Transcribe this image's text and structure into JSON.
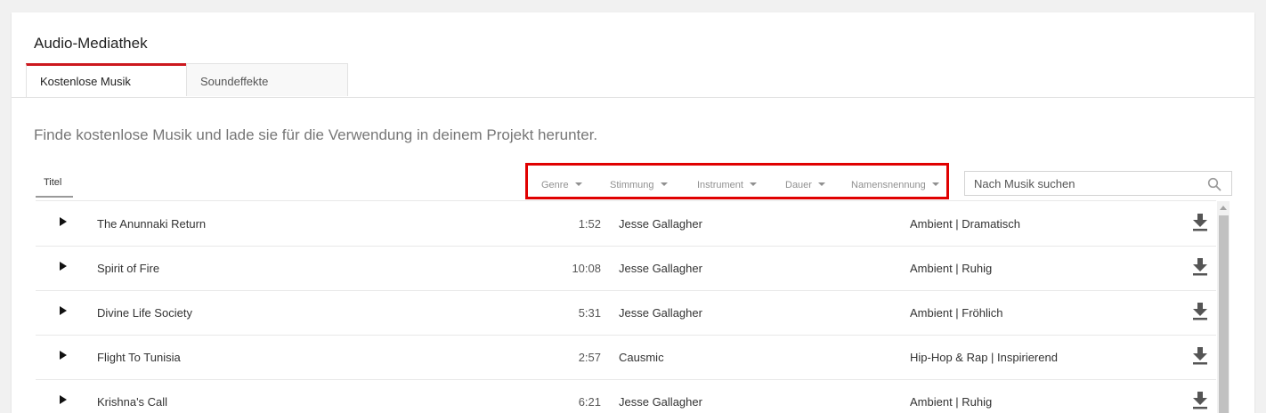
{
  "header": {
    "title": "Audio-Mediathek"
  },
  "tabs": [
    {
      "label": "Kostenlose Musik",
      "active": true
    },
    {
      "label": "Soundeffekte",
      "active": false
    }
  ],
  "subtitle": "Finde kostenlose Musik und lade sie für die Verwendung in deinem Projekt herunter.",
  "columns": {
    "title": "Titel"
  },
  "filters": [
    {
      "label": "Genre"
    },
    {
      "label": "Stimmung"
    },
    {
      "label": "Instrument"
    },
    {
      "label": "Dauer"
    },
    {
      "label": "Namensnennung"
    }
  ],
  "search": {
    "placeholder": "Nach Musik suchen",
    "value": ""
  },
  "tracks": [
    {
      "title": "The Anunnaki Return",
      "duration": "1:52",
      "artist": "Jesse Gallagher",
      "genre": "Ambient | Dramatisch"
    },
    {
      "title": "Spirit of Fire",
      "duration": "10:08",
      "artist": "Jesse Gallagher",
      "genre": "Ambient | Ruhig"
    },
    {
      "title": "Divine Life Society",
      "duration": "5:31",
      "artist": "Jesse Gallagher",
      "genre": "Ambient | Fröhlich"
    },
    {
      "title": "Flight To Tunisia",
      "duration": "2:57",
      "artist": "Causmic",
      "genre": "Hip-Hop & Rap | Inspirierend"
    },
    {
      "title": "Krishna's Call",
      "duration": "6:21",
      "artist": "Jesse Gallagher",
      "genre": "Ambient | Ruhig"
    }
  ],
  "colors": {
    "accent": "#cc181e",
    "highlight_box": "#e00000"
  },
  "icons": {
    "play": "play-icon",
    "download": "download-icon",
    "search": "search-icon"
  }
}
